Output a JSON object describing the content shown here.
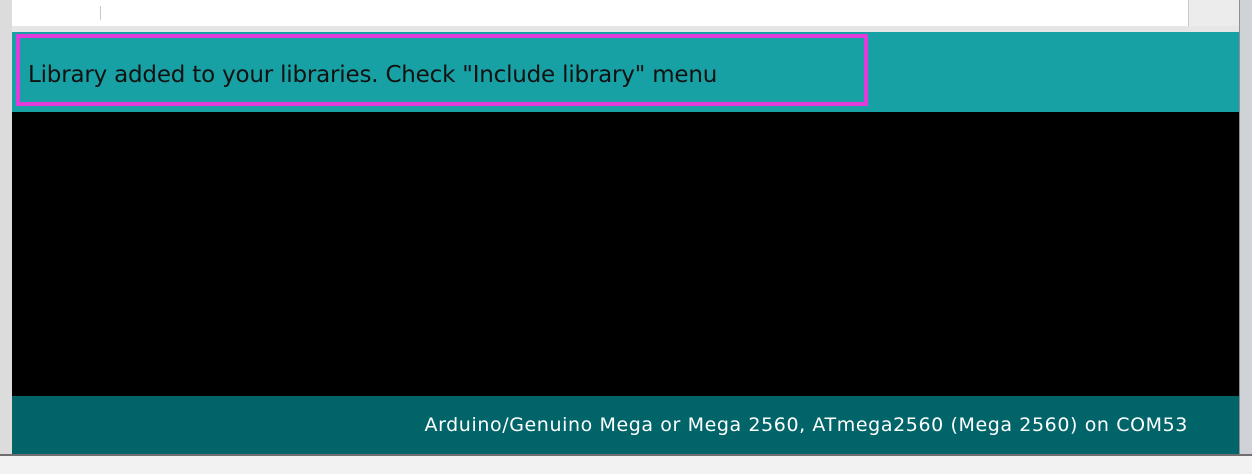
{
  "message_bar": {
    "text": "Library added to your libraries. Check \"Include library\" menu"
  },
  "console": {
    "lines": []
  },
  "status_bar": {
    "board_info": "Arduino/Genuino Mega or Mega 2560, ATmega2560 (Mega 2560) on COM53"
  },
  "colors": {
    "message_bar_bg": "#17a1a5",
    "highlight_border": "#e23bdc",
    "console_bg": "#000000",
    "status_bar_bg": "#006468"
  }
}
